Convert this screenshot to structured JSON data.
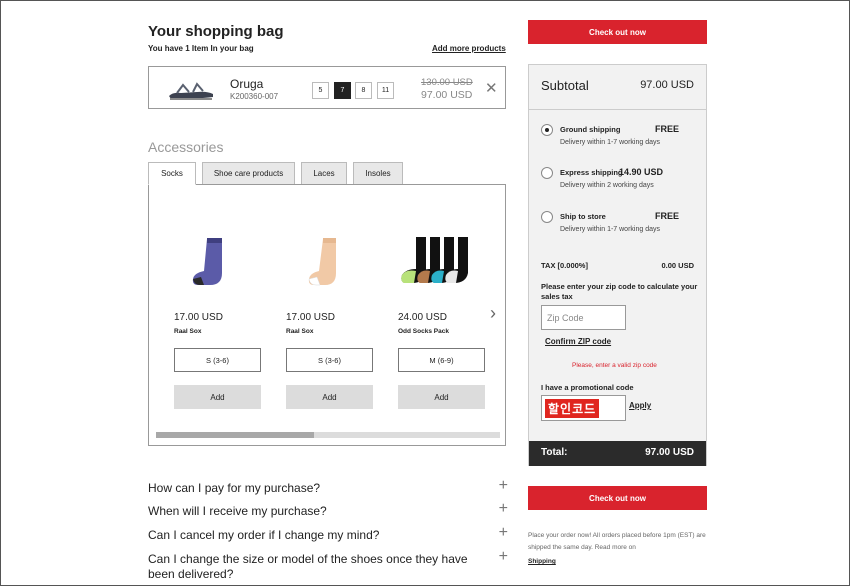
{
  "bag": {
    "title": "Your shopping bag",
    "subtitle": "You have  1 Item In your bag",
    "add_more": "Add more products",
    "item": {
      "name": "Oruga",
      "code": "K200360-007",
      "sizes": [
        "5",
        "7",
        "8",
        "11"
      ],
      "selected_size": "7",
      "price_old": "130.00 USD",
      "price_new": "97.00 USD",
      "remove_icon": "close-icon"
    }
  },
  "accessories": {
    "title": "Accessories",
    "tabs": [
      "Socks",
      "Shoe care products",
      "Laces",
      "Insoles"
    ],
    "active_tab": "Socks",
    "products": [
      {
        "price": "17.00 USD",
        "name": "Raal Sox",
        "size": "S (3-6)",
        "add": "Add"
      },
      {
        "price": "17.00 USD",
        "name": "Raal Sox",
        "size": "S (3-6)",
        "add": "Add"
      },
      {
        "price": "24.00 USD",
        "name": "Odd Socks Pack",
        "size": "M (6-9)",
        "add": "Add"
      }
    ],
    "next_icon": "chevron-right-icon",
    "scroll_position": 0.46
  },
  "faq": [
    "How can I pay for my purchase?",
    "When will I receive my purchase?",
    "Can I cancel my order if I change my mind?",
    "Can I change the size or model of the shoes once they have been delivered?"
  ],
  "summary": {
    "checkout": "Check out now",
    "subtotal_label": "Subtotal",
    "subtotal_value": "97.00 USD",
    "shipping": [
      {
        "name": "Ground shipping",
        "price": "FREE",
        "note": "Delivery within 1-7 working days",
        "selected": true
      },
      {
        "name": "Express shipping",
        "price": "14.90 USD",
        "note": "Delivery within 2 working days",
        "selected": false
      },
      {
        "name": "Ship to store",
        "price": "FREE",
        "note": "Delivery within 1-7 working days",
        "selected": false
      }
    ],
    "tax_label": "TAX [0.000%]",
    "tax_value": "0.00 USD",
    "zip_prompt": "Please enter your zip code to calculate your sales tax",
    "zip_placeholder": "Zip Code",
    "confirm_zip": "Confirm ZIP code",
    "zip_error": "Please, enter a valid zip code",
    "promo_label": "I have a promotional code",
    "promo_code": "할인코드",
    "apply": "Apply",
    "total_label": "Total:",
    "total_value": "97.00 USD",
    "note": "Place your order now! All orders placed before 1pm (EST) are shipped the same day. Read more on",
    "shipping_link": "Shipping"
  },
  "colors": {
    "accent": "#d9232d",
    "total_bar": "#2b2b2b",
    "summary_bg": "#f2f2f2"
  }
}
